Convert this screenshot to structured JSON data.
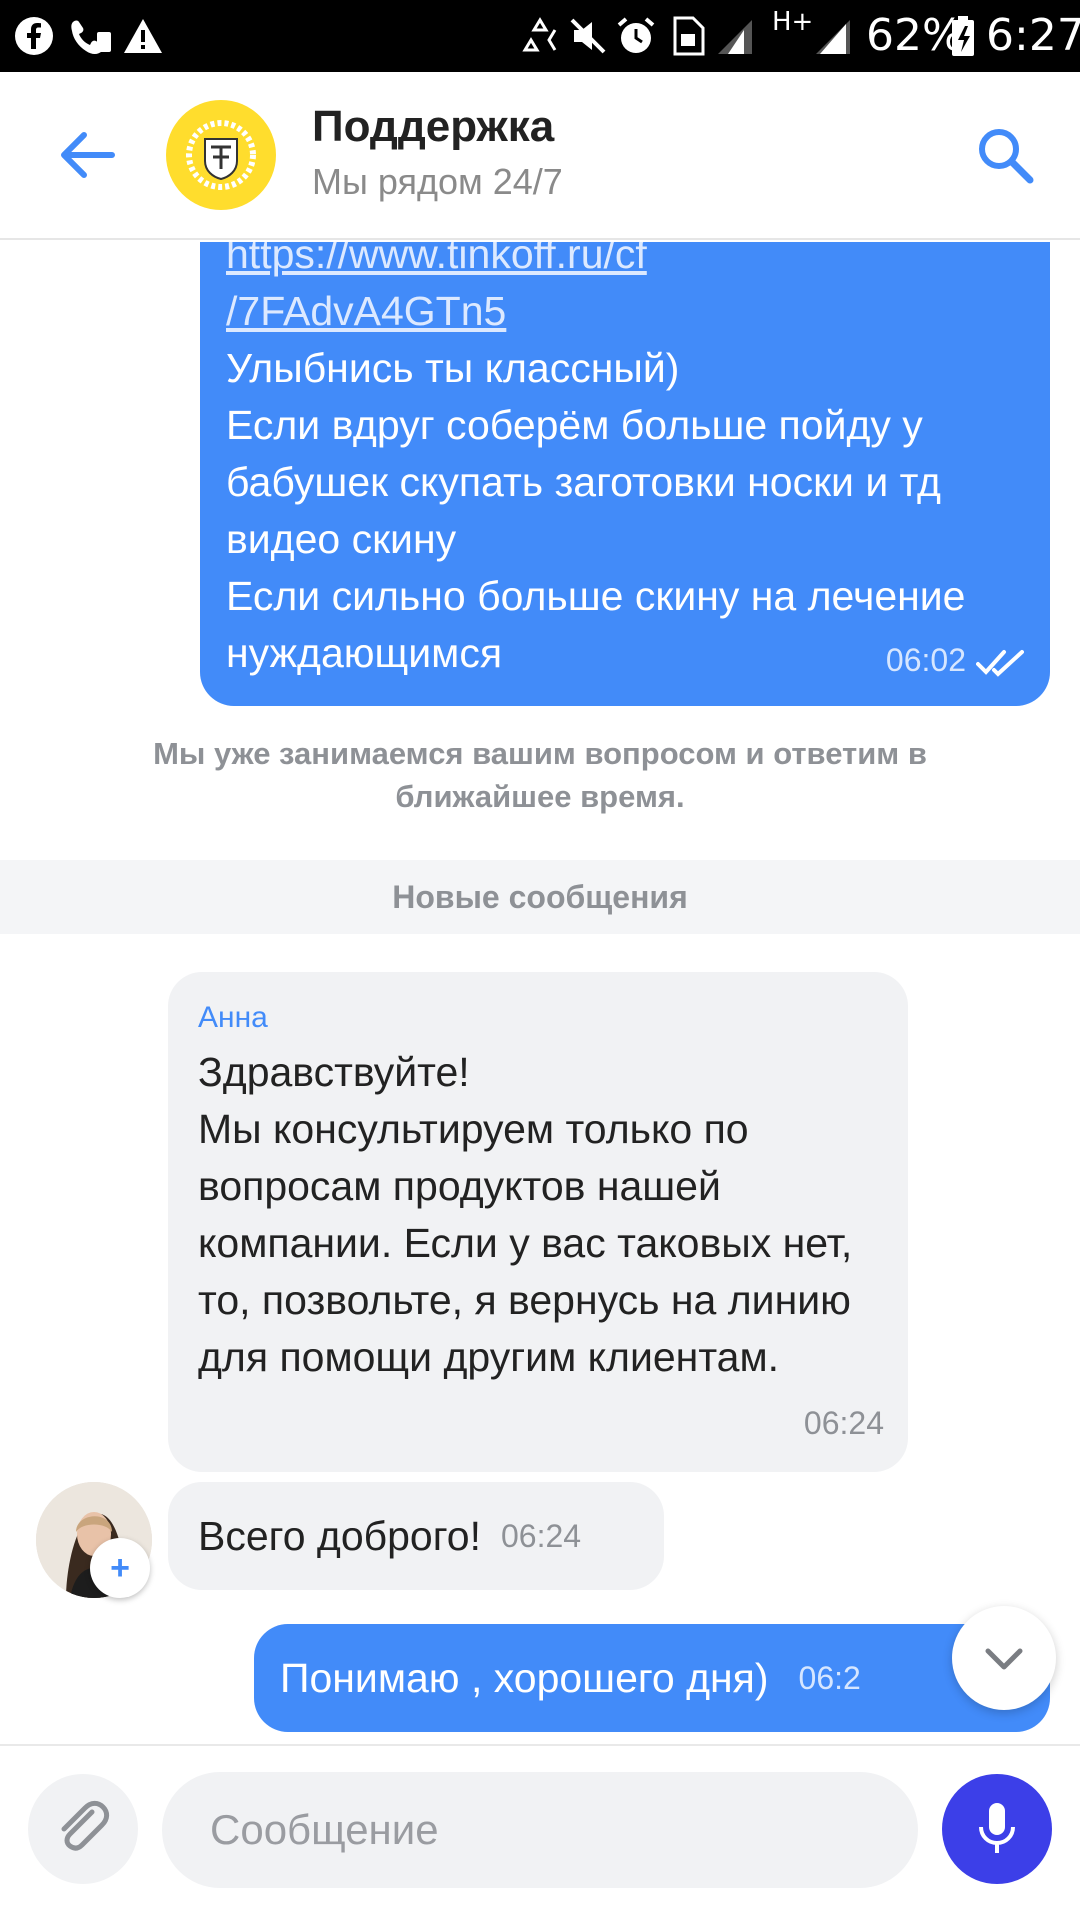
{
  "status_bar": {
    "battery": "62%",
    "time": "6:27",
    "network_type": "H+",
    "left_icons": [
      "facebook-icon",
      "wifi-calling-icon",
      "warning-icon"
    ],
    "right_icons": [
      "recycle-icon",
      "mute-icon",
      "alarm-icon",
      "sim-icon",
      "signal-icon",
      "signal-icon",
      "battery-icon"
    ]
  },
  "header": {
    "title": "Поддержка",
    "subtitle": "Мы рядом 24/7",
    "logo_color": "#ffdd2d"
  },
  "messages": {
    "outgoing_1": {
      "link_lines": [
        "https://www.tinkoff.ru/cf",
        "/7FAdvA4GTn5"
      ],
      "text": "Улыбнись ты классный)\nЕсли вдруг соберём больше пойду у бабушек скупать заготовки носки и тд видео скину\nЕсли сильно больше скину на лечение нуждающимся",
      "time": "06:02"
    },
    "system_note": "Мы уже занимаемся вашим вопросом и ответим в ближайшее время.",
    "new_messages_divider": "Новые сообщения",
    "incoming_1": {
      "author": "Анна",
      "text": "Здравствуйте!\nМы консультируем только по вопросам продуктов нашей компании. Если у вас таковых нет, то, позвольте, я вернусь на линию для помощи другим клиентам.",
      "time": "06:24"
    },
    "incoming_2": {
      "text": "Всего доброго!",
      "time": "06:24"
    },
    "outgoing_2": {
      "text": "Понимаю , хорошего дня)",
      "time": "06:2"
    }
  },
  "input": {
    "placeholder": "Сообщение"
  },
  "colors": {
    "outgoing_bubble": "#428bf9",
    "incoming_bubble": "#f1f2f4",
    "mic_button": "#3c3fe8",
    "accent": "#428bf9"
  }
}
